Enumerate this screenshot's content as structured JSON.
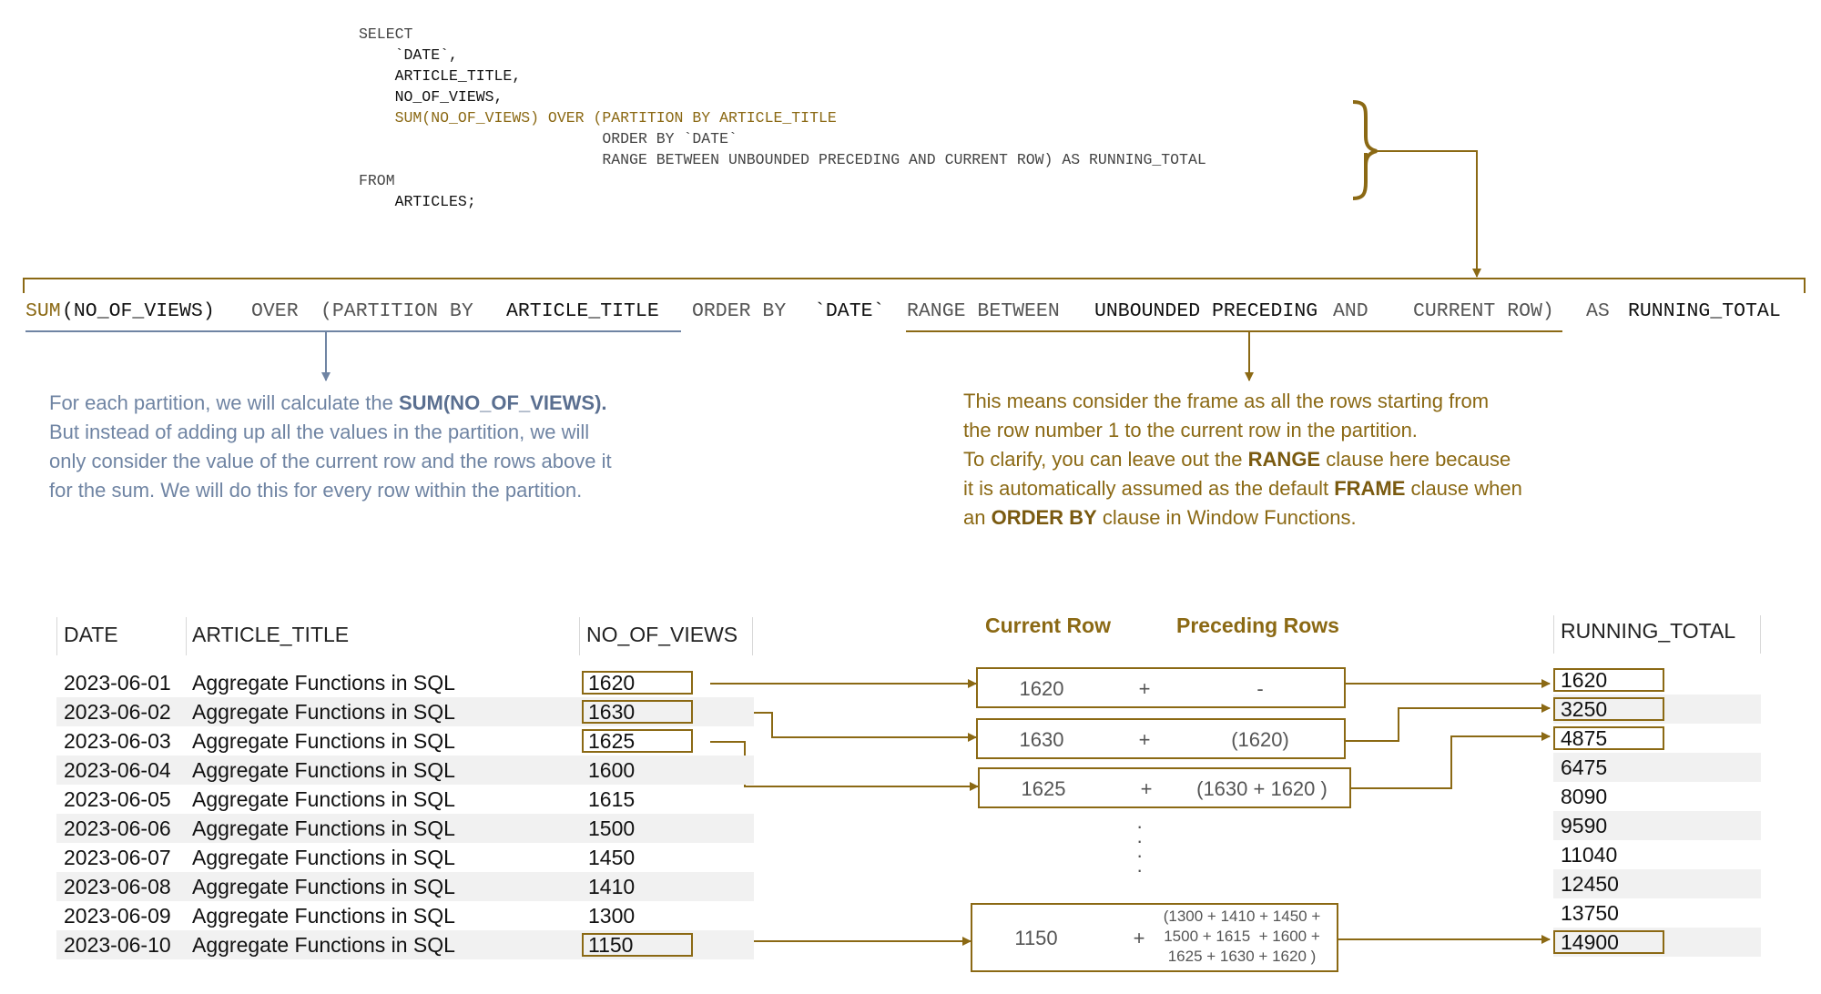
{
  "sql": {
    "lines": [
      "SELECT",
      "    `DATE`,",
      "    ARTICLE_TITLE,",
      "    NO_OF_VIEWS,",
      "    SUM(NO_OF_VIEWS) OVER (PARTITION BY ARTICLE_TITLE",
      "                           ORDER BY `DATE`",
      "                           RANGE BETWEEN UNBOUNDED PRECEDING AND CURRENT ROW) AS RUNNING_TOTAL",
      "FROM",
      "    ARTICLES;"
    ]
  },
  "formula": {
    "sum": "SUM",
    "arg": "(NO_OF_VIEWS)",
    "over": "OVER",
    "partition_open": "(PARTITION BY",
    "partition_col": "ARTICLE_TITLE",
    "order_by": "ORDER BY",
    "order_col": "`DATE`",
    "range_between": "RANGE BETWEEN",
    "unbounded_preceding": "UNBOUNDED PRECEDING",
    "and": "AND",
    "current_row": "CURRENT ROW)",
    "as": "AS",
    "alias": "RUNNING_TOTAL"
  },
  "notes": {
    "left": {
      "l1a": "For each partition, we will calculate the ",
      "l1b": "SUM(NO_OF_VIEWS).",
      "l2": "But instead of adding up all the values in the partition, we will",
      "l3": "only consider the value of the current row and the rows above it",
      "l4": "for the sum. We will do this for every row within the partition."
    },
    "right": {
      "l1": "This means consider the frame as all the rows starting from",
      "l2": "the row number 1 to the current row in the partition.",
      "l3a": "To clarify, you can leave out the ",
      "l3b": "RANGE",
      "l3c": " clause here because",
      "l4a": "it is automatically assumed as the default ",
      "l4b": "FRAME",
      "l4c": " clause when",
      "l5a": "an ",
      "l5b": "ORDER BY",
      "l5c": " clause in Window Functions."
    }
  },
  "table": {
    "headers": {
      "date": "DATE",
      "title": "ARTICLE_TITLE",
      "views": "NO_OF_VIEWS"
    },
    "rows": [
      {
        "date": "2023-06-01",
        "title": "Aggregate Functions in SQL",
        "views": "1620"
      },
      {
        "date": "2023-06-02",
        "title": "Aggregate Functions in SQL",
        "views": "1630"
      },
      {
        "date": "2023-06-03",
        "title": "Aggregate Functions in SQL",
        "views": "1625"
      },
      {
        "date": "2023-06-04",
        "title": "Aggregate Functions in SQL",
        "views": "1600"
      },
      {
        "date": "2023-06-05",
        "title": "Aggregate Functions in SQL",
        "views": "1615"
      },
      {
        "date": "2023-06-06",
        "title": "Aggregate Functions in SQL",
        "views": "1500"
      },
      {
        "date": "2023-06-07",
        "title": "Aggregate Functions in SQL",
        "views": "1450"
      },
      {
        "date": "2023-06-08",
        "title": "Aggregate Functions in SQL",
        "views": "1410"
      },
      {
        "date": "2023-06-09",
        "title": "Aggregate Functions in SQL",
        "views": "1300"
      },
      {
        "date": "2023-06-10",
        "title": "Aggregate Functions in SQL",
        "views": "1150"
      }
    ]
  },
  "calc": {
    "current_row_header": "Current Row",
    "preceding_rows_header": "Preceding Rows",
    "plus": "+",
    "rows": [
      {
        "current": "1620",
        "preceding": "-"
      },
      {
        "current": "1630",
        "preceding": "(1620)"
      },
      {
        "current": "1625",
        "preceding": "(1630 + 1620 )"
      },
      {
        "current": "1150",
        "preceding": "(1300 + 1410 + 1450 +\n1500 + 1615  + 1600 +\n1625 + 1630 + 1620 )"
      }
    ]
  },
  "running_total": {
    "header": "RUNNING_TOTAL",
    "values": [
      "1620",
      "3250",
      "4875",
      "6475",
      "8090",
      "9590",
      "11040",
      "12450",
      "13750",
      "14900"
    ]
  },
  "colors": {
    "gold": "#8b6914",
    "slate": "#6f84a3"
  }
}
